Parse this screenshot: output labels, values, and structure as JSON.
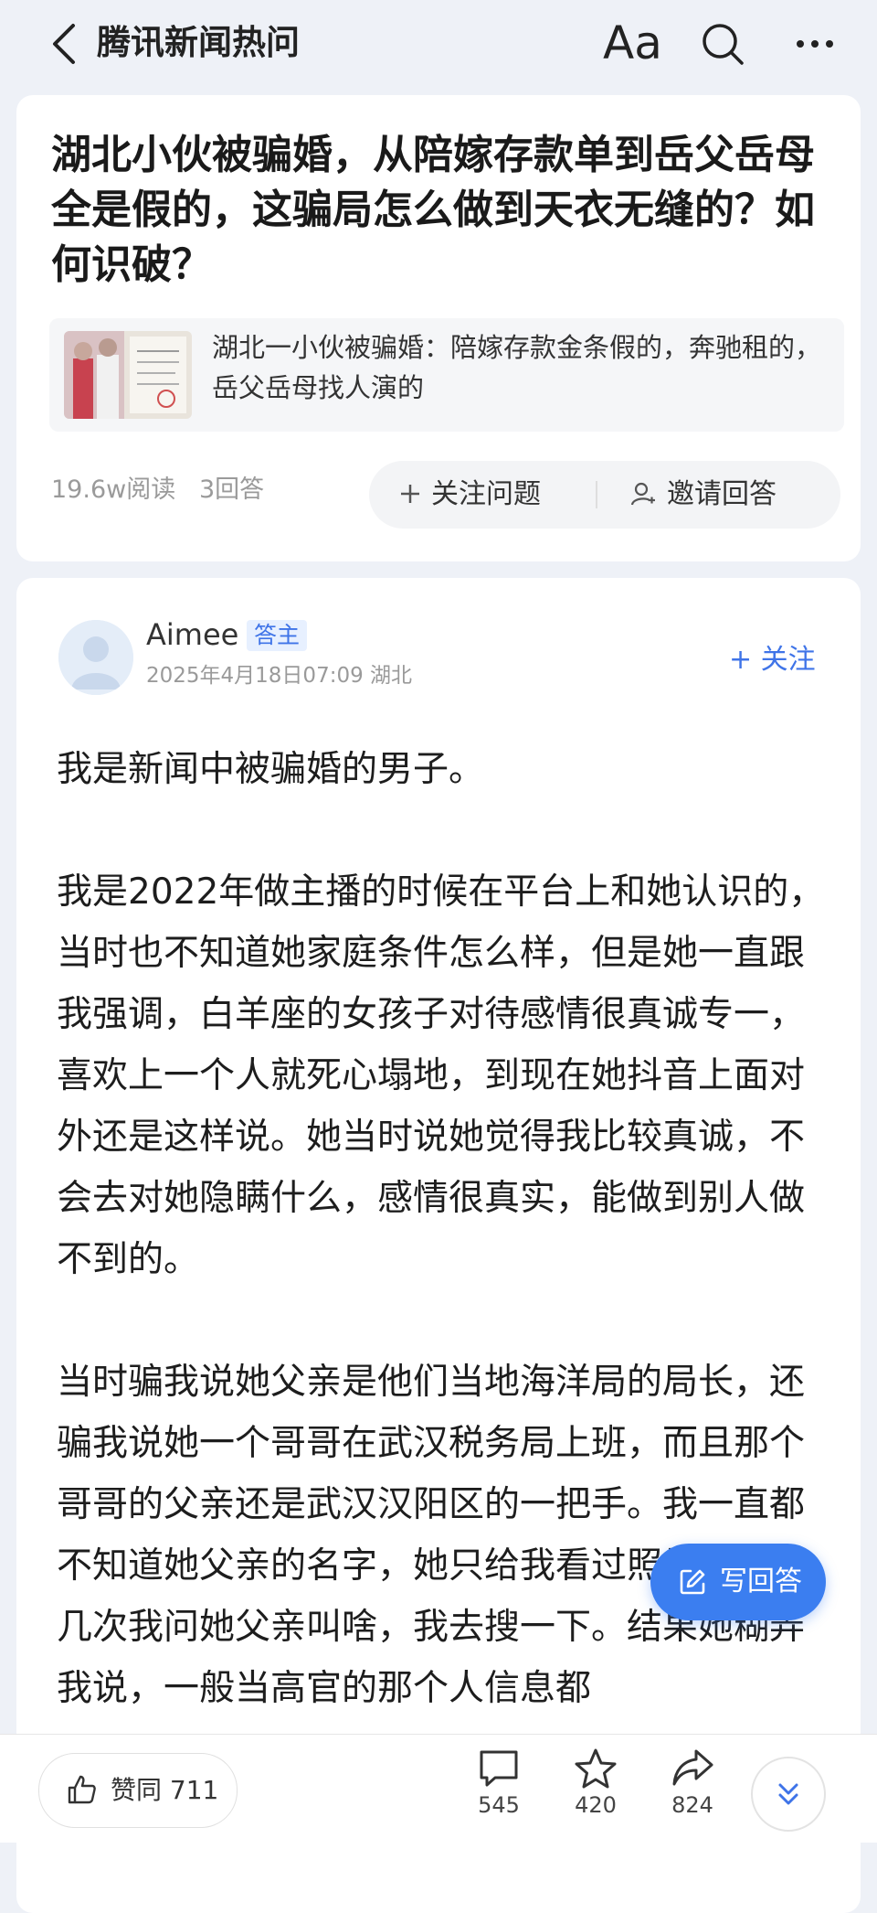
{
  "nav": {
    "title": "腾讯新闻热问",
    "font_button": "Aa"
  },
  "question": {
    "title": "湖北小伙被骗婚，从陪嫁存款单到岳父岳母全是假的，这骗局怎么做到天衣无缝的？如何识破？",
    "news_link_text": "湖北一小伙被骗婚：陪嫁存款金条假的，奔驰租的，岳父岳母找人演的",
    "reads": "19.6w阅读",
    "answers": "3回答",
    "follow_label": "关注问题",
    "invite_label": "邀请回答"
  },
  "answer": {
    "author": "Aimee",
    "badge": "答主",
    "time_location": "2025年4月18日07:09 湖北",
    "follow_label": "+ 关注",
    "paragraphs": [
      "我是新闻中被骗婚的男子。",
      "我是2022年做主播的时候在平台上和她认识的，当时也不知道她家庭条件怎么样，但是她一直跟我强调，白羊座的女孩子对待感情很真诚专一，喜欢上一个人就死心塌地，到现在她抖音上面对外还是这样说。她当时说她觉得我比较真诚，不会去对她隐瞒什么，感情很真实，能做到别人做不到的。",
      "当时骗我说她父亲是他们当地海洋局的局长，还骗我说她一个哥哥在武汉税务局上班，而且那个哥哥的父亲还是武汉汉阳区的一把手。我一直都不知道她父亲的名字，她只给我看过照片。有好几次我问她父亲叫啥，我去搜一下。结果她糊弄我说，一般当高官的那个人信息都"
    ]
  },
  "write_button": "写回答",
  "bottom": {
    "like_label": "赞同 711",
    "comments": "545",
    "favorites": "420",
    "shares": "824"
  },
  "colors": {
    "accent": "#3b7ef0",
    "link_blue": "#3f74e8",
    "page_bg": "#eef1f7"
  }
}
